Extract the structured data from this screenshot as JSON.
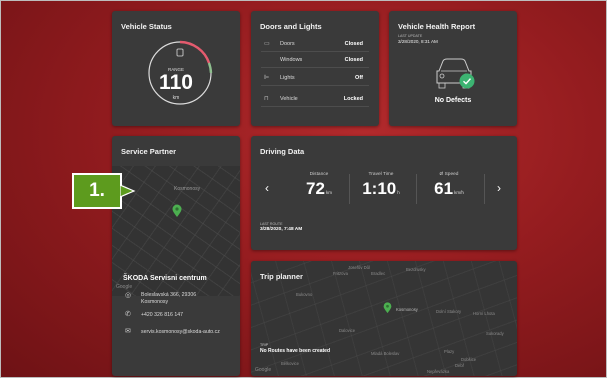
{
  "vehicle_status": {
    "title": "Vehicle Status",
    "range_label": "RANGE",
    "range_value": "110",
    "range_unit": "km",
    "fuel_level": 0.3,
    "accent": "#e45b6e"
  },
  "doors_lights": {
    "title": "Doors and Lights",
    "rows": [
      {
        "icon": "door-icon",
        "label": "Doors",
        "value": "Closed"
      },
      {
        "icon": "",
        "label": "Windows",
        "value": "Closed"
      },
      {
        "icon": "light-icon",
        "label": "Lights",
        "value": "Off"
      },
      {
        "icon": "lock-icon",
        "label": "Vehicle",
        "value": "Locked"
      }
    ]
  },
  "health": {
    "title": "Vehicle Health Report",
    "last_update_label": "LAST UPDATE",
    "last_update": "3/28/2020, 8:31 AM",
    "status": "No Defects",
    "ok_color": "#3cb371"
  },
  "service_partner": {
    "title": "Service Partner",
    "map_label": "Kosmonosy",
    "map_brand": "Google",
    "name": "ŠKODA Servisni centrum",
    "address_1": "Boleslavská 366, 29306",
    "address_2": "Kosmonosy",
    "phone": "+420 326 816 147",
    "email": "servis.kosmonosy@skoda-auto.cz",
    "pin_color": "#4caf50"
  },
  "driving": {
    "title": "Driving Data",
    "stats": [
      {
        "label": "Distance",
        "value": "72",
        "unit": "km"
      },
      {
        "label": "Travel Time",
        "value": "1:10",
        "unit": "h"
      },
      {
        "label": "Ø Speed",
        "value": "61",
        "unit": "km/h"
      }
    ],
    "last_route_label": "LAST ROUTE",
    "last_route": "3/28/2020, 7:48 AM"
  },
  "trip": {
    "title": "Trip planner",
    "trip_label": "TRIP",
    "status": "No Routes have been created",
    "map_brand": "Google",
    "places": [
      "Josefův Důl",
      "Fritzova",
      "Bradlec",
      "Bezdrusky",
      "Kosmonosy",
      "Dolní Stakory",
      "Horní Lhota",
      "Dalovice",
      "Mladá Boleslav",
      "Plazy",
      "Sukorady",
      "Debř",
      "Nepřevázka",
      "Bukovno",
      "Dobšice",
      "Bělkovice"
    ]
  },
  "callout": {
    "label": "1.",
    "color": "#5d9b1e"
  }
}
